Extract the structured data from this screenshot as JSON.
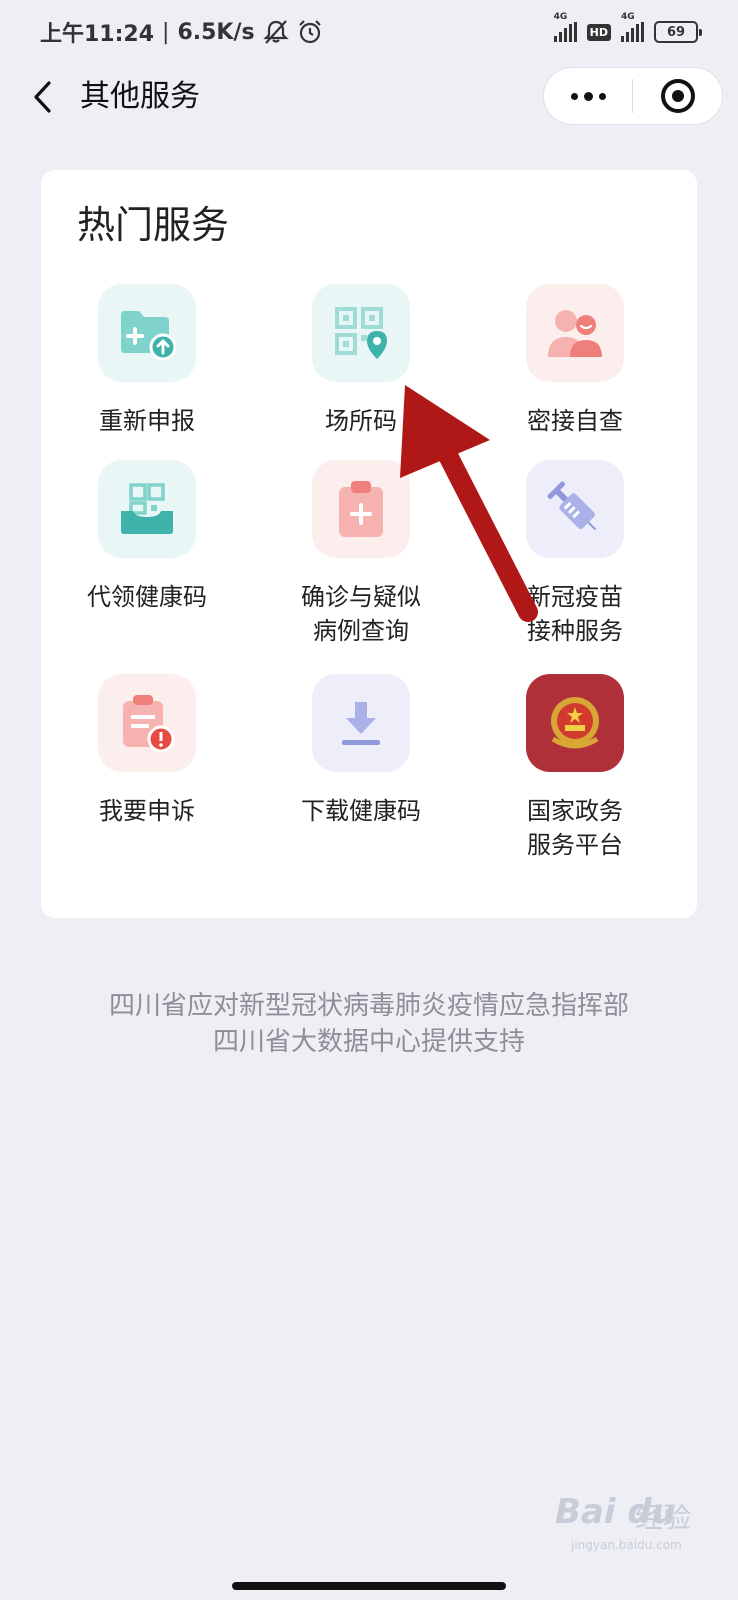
{
  "status_bar": {
    "time": "上午11:24",
    "speed": "6.5K/s",
    "sig1_label": "4G",
    "hd_label": "HD",
    "sig2_label": "4G",
    "battery": "69"
  },
  "nav": {
    "title": "其他服务"
  },
  "section": {
    "title": "热门服务",
    "items": [
      {
        "label": "重新申报",
        "icon": "folder-upload-icon"
      },
      {
        "label": "场所码",
        "icon": "qr-location-icon"
      },
      {
        "label": "密接自查",
        "icon": "people-icon"
      },
      {
        "label": "代领健康码",
        "icon": "qr-tray-icon"
      },
      {
        "label": "确诊与疑似\n病例查询",
        "icon": "clipboard-medical-icon"
      },
      {
        "label": "新冠疫苗\n接种服务",
        "icon": "syringe-icon"
      },
      {
        "label": "我要申诉",
        "icon": "complaint-icon"
      },
      {
        "label": "下载健康码",
        "icon": "download-icon"
      },
      {
        "label": "国家政务\n服务平台",
        "icon": "national-emblem-icon"
      }
    ]
  },
  "footer": {
    "line1": "四川省应对新型冠状病毒肺炎疫情应急指挥部",
    "line2": "四川省大数据中心提供支持"
  },
  "watermark": {
    "brand": "Bai du",
    "text": "经验",
    "url": "jingyan.baidu.com"
  },
  "colors": {
    "background": "#eeeff4",
    "teal": "#5cc4bc",
    "pink": "#f08c8c",
    "lavender": "#8f98dd",
    "gov_red": "#b0303a",
    "arrow_red": "#b01818"
  }
}
